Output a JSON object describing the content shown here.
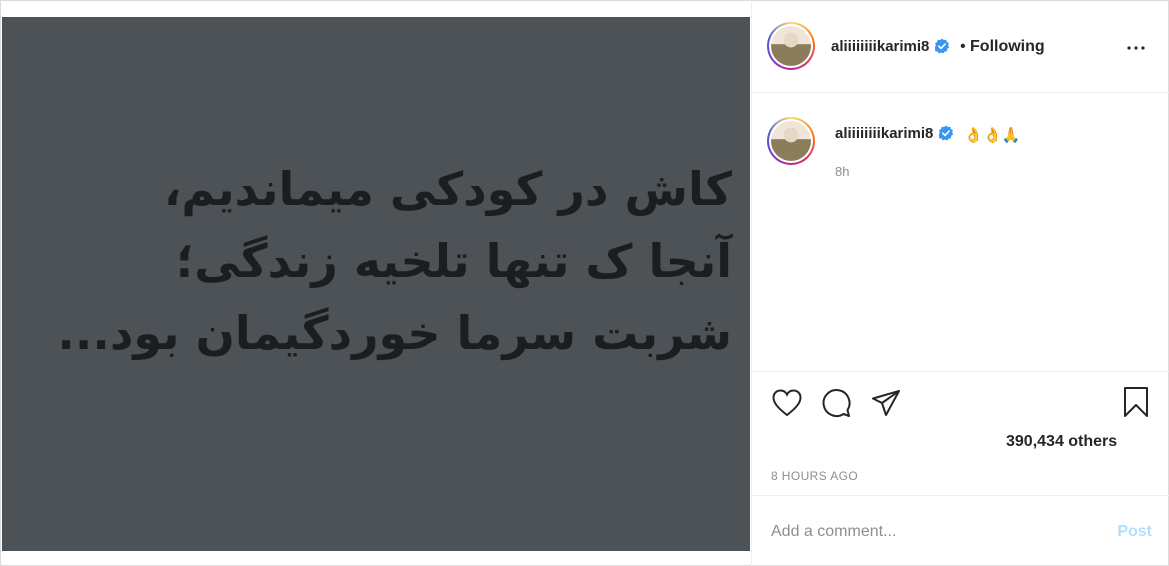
{
  "post": {
    "image_text_lines": [
      "کاش در کودکی میماندیم،",
      "آنجا ک تنها تلخیه زندگی؛",
      "شربت سرما خوردگیمان بود..."
    ],
    "image_background": "#4d5257"
  },
  "header": {
    "username": "aliiiiiiiikarimi8",
    "separator": "•",
    "follow_status": "Following",
    "more_icon": "ellipsis-icon",
    "verified_icon": "verified-badge-icon"
  },
  "caption": {
    "username": "aliiiiiiiikarimi8",
    "text": "👌👌🙏",
    "time": "8h"
  },
  "actions": {
    "likes": "390,434 others",
    "posted_time": "8 HOURS AGO"
  },
  "comment": {
    "placeholder": "Add a comment...",
    "post_label": "Post"
  },
  "colors": {
    "verified": "#3897f0",
    "post_disabled": "#b2dffc",
    "muted": "#8e8e8e"
  }
}
